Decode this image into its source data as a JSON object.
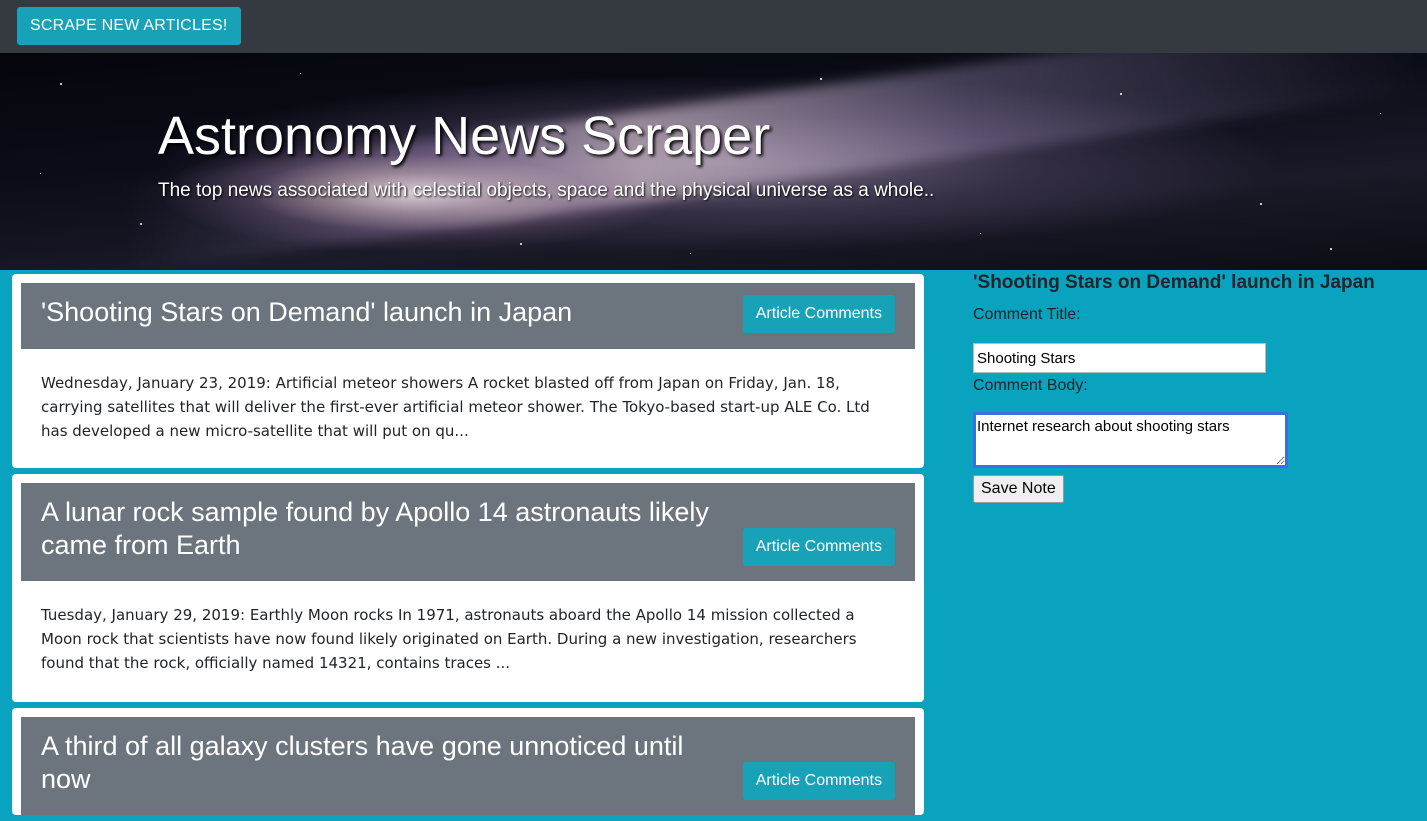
{
  "navbar": {
    "scrape_button": "SCRAPE NEW ARTICLES!"
  },
  "hero": {
    "title": "Astronomy News Scraper",
    "subtitle": "The top news associated with celestial objects, space and the physical universe as a whole.."
  },
  "articles": [
    {
      "title": "'Shooting Stars on Demand' launch in Japan",
      "button": "Article Comments",
      "summary": "Wednesday, January 23, 2019: Artificial meteor showers A rocket blasted off from Japan on Friday, Jan. 18, carrying satellites that will deliver the first-ever artificial meteor shower. The Tokyo-based start-up ALE Co. Ltd has developed a new micro-satellite that will put on qu..."
    },
    {
      "title": "A lunar rock sample found by Apollo 14 astronauts likely came from Earth",
      "button": "Article Comments",
      "summary": "Tuesday, January 29, 2019: Earthly Moon rocks In 1971, astronauts aboard the Apollo 14 mission collected a Moon rock that scientists have now found likely originated on Earth. During a new investigation, researchers found that the rock, officially named 14321, contains traces ..."
    },
    {
      "title": "A third of all galaxy clusters have gone unnoticed until now",
      "button": "Article Comments",
      "summary": ""
    }
  ],
  "note_panel": {
    "heading": "'Shooting Stars on Demand' launch in Japan",
    "title_label": "Comment Title:",
    "title_value": "Shooting Stars",
    "body_label": "Comment Body:",
    "body_value": "Internet research about shooting stars",
    "save_button": "Save Note"
  }
}
